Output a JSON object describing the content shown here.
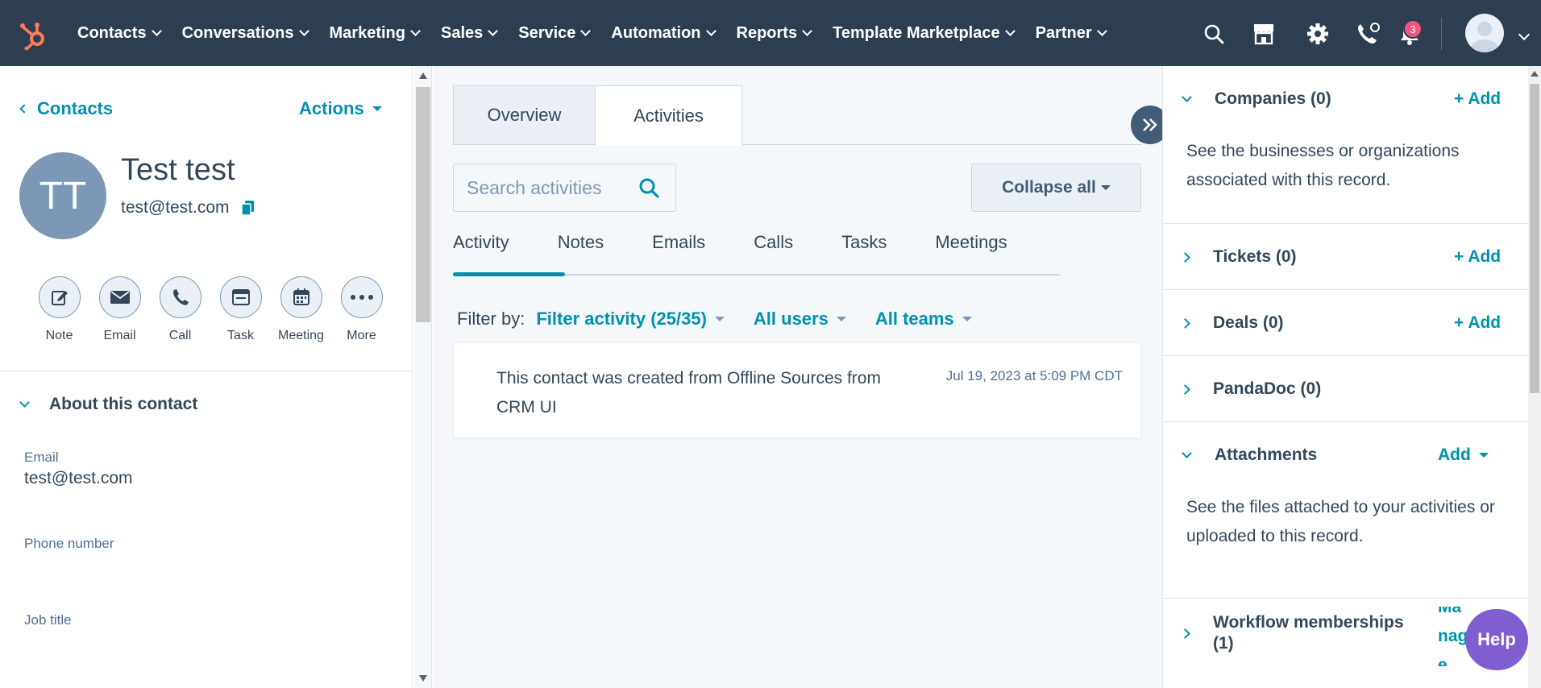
{
  "topnav": {
    "items": [
      {
        "label": "Contacts"
      },
      {
        "label": "Conversations"
      },
      {
        "label": "Marketing"
      },
      {
        "label": "Sales"
      },
      {
        "label": "Service"
      },
      {
        "label": "Automation"
      },
      {
        "label": "Reports"
      },
      {
        "label": "Template Marketplace"
      },
      {
        "label": "Partner"
      }
    ],
    "icons": [
      "search-icon",
      "marketplace-icon",
      "settings-icon",
      "calling-icon",
      "notifications-icon"
    ],
    "notification_count": "3",
    "colors": {
      "bar": "#2d3e50",
      "logo": "#ff7a59",
      "badge": "#f2547d"
    }
  },
  "contact": {
    "back_label": "Contacts",
    "actions_label": "Actions",
    "initials": "TT",
    "name": "Test test",
    "email": "test@test.com",
    "quick_actions": [
      {
        "label": "Note",
        "icon": "note-icon"
      },
      {
        "label": "Email",
        "icon": "email-icon"
      },
      {
        "label": "Call",
        "icon": "call-icon"
      },
      {
        "label": "Task",
        "icon": "task-icon"
      },
      {
        "label": "Meeting",
        "icon": "meeting-icon"
      },
      {
        "label": "More",
        "icon": "more-icon"
      }
    ],
    "about_title": "About this contact",
    "properties": [
      {
        "label": "Email",
        "value": "test@test.com"
      },
      {
        "label": "Phone number",
        "value": ""
      },
      {
        "label": "Job title",
        "value": ""
      }
    ]
  },
  "middle": {
    "tabs": [
      {
        "label": "Overview"
      },
      {
        "label": "Activities"
      }
    ],
    "active_tab": "Activities",
    "search_placeholder": "Search activities",
    "collapse_label": "Collapse all",
    "sub_tabs": [
      {
        "label": "Activity"
      },
      {
        "label": "Notes"
      },
      {
        "label": "Emails"
      },
      {
        "label": "Calls"
      },
      {
        "label": "Tasks"
      },
      {
        "label": "Meetings"
      }
    ],
    "active_sub_tab": "Activity",
    "filter_label": "Filter by:",
    "filters": [
      {
        "label": "Filter activity (25/35)"
      },
      {
        "label": "All users"
      },
      {
        "label": "All teams"
      }
    ],
    "activity": {
      "text": "This contact was created from Offline Sources from CRM UI",
      "timestamp": "Jul 19, 2023 at 5:09 PM CDT"
    },
    "accent": "#0091ae"
  },
  "right": {
    "cards": [
      {
        "title": "Companies (0)",
        "action": "+ Add",
        "expanded": true,
        "description": "See the businesses or organizations associated with this record."
      },
      {
        "title": "Tickets (0)",
        "action": "+ Add",
        "expanded": false
      },
      {
        "title": "Deals (0)",
        "action": "+ Add",
        "expanded": false
      },
      {
        "title": "PandaDoc (0)",
        "action": "",
        "expanded": false
      },
      {
        "title": "Attachments",
        "action": "Add",
        "expanded": true,
        "description": "See the files attached to your activities or uploaded to this record."
      },
      {
        "title": "Workflow memberships (1)",
        "action": "Manage",
        "expanded": false
      }
    ],
    "help_label": "Help",
    "help_color": "#7f5ed2"
  }
}
